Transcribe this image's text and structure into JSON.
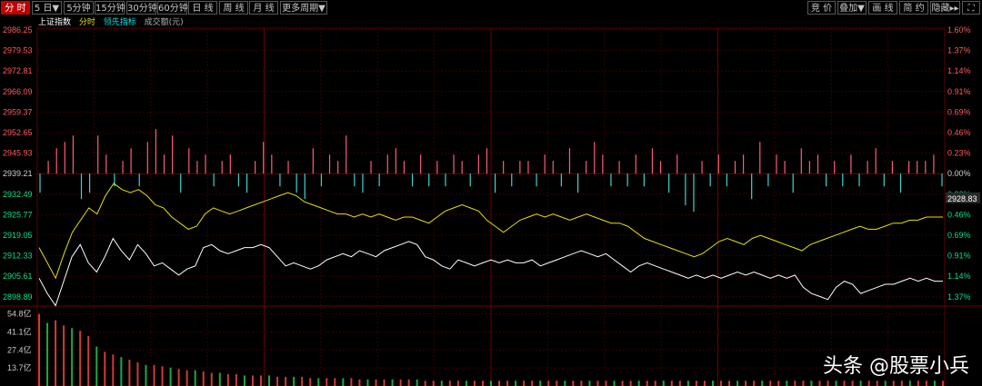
{
  "toolbar": {
    "left": [
      {
        "label": "分 时",
        "name": "tab-intraday",
        "active": true
      },
      {
        "label": "5 日▼",
        "name": "tab-5day",
        "active": false
      },
      {
        "label": "5分钟",
        "name": "tab-5min",
        "active": false
      },
      {
        "label": "15分钟",
        "name": "tab-15min",
        "active": false
      },
      {
        "label": "30分钟",
        "name": "tab-30min",
        "active": false
      },
      {
        "label": "60分钟",
        "name": "tab-60min",
        "active": false
      },
      {
        "label": "日 线",
        "name": "tab-daily",
        "active": false
      },
      {
        "label": "周 线",
        "name": "tab-weekly",
        "active": false
      },
      {
        "label": "月 线",
        "name": "tab-monthly",
        "active": false
      },
      {
        "label": "更多周期▼",
        "name": "tab-more-periods",
        "active": false
      }
    ],
    "right": [
      {
        "label": "竞 价",
        "name": "btn-auction"
      },
      {
        "label": "叠加▼",
        "name": "btn-overlay"
      },
      {
        "label": "画 线",
        "name": "btn-draw"
      },
      {
        "label": "简 约",
        "name": "btn-simple"
      },
      {
        "label": "隐藏▸▸",
        "name": "btn-hide"
      },
      {
        "label": "⛶",
        "name": "btn-fullscreen"
      }
    ]
  },
  "legend": {
    "index": "上证指数",
    "time": "分时",
    "leading": "领先指标",
    "volume": "成交额(元)"
  },
  "colors": {
    "up": "#ff4a4a",
    "down": "#00ff9c",
    "white_line": "#ffffff",
    "yellow_line": "#e3e300",
    "grid": "#3a0000",
    "volume_green": "#1aa84a",
    "volume_red": "#d03a3a"
  },
  "chart_data": {
    "type": "line",
    "price_axis": {
      "ticks": [
        2986.25,
        2979.53,
        2972.81,
        2966.09,
        2959.37,
        2952.65,
        2945.93,
        2939.21,
        2932.49,
        2925.77,
        2919.05,
        2912.33,
        2905.61,
        2898.89
      ],
      "tick_labels": [
        "2986.25",
        "2979.53",
        "2972.81",
        "2966.09",
        "2959.37",
        "2952.65",
        "2945.93",
        "2939.21",
        "2932.49",
        "2925.77",
        "2919.05",
        "2912.33",
        "2905.61",
        "2898.89"
      ],
      "base": 2939.21
    },
    "pct_axis": {
      "tick_labels": [
        "1.60%",
        "1.37%",
        "1.14%",
        "0.91%",
        "0.69%",
        "0.46%",
        "0.23%",
        "0.00%",
        "0.23%",
        "0.46%",
        "0.69%",
        "0.91%",
        "1.14%",
        "1.37%"
      ]
    },
    "current_price_label": "2928.83",
    "volume_axis": {
      "tick_labels": [
        "54.8亿",
        "41.1亿",
        "27.4亿",
        "13.7亿"
      ],
      "ticks": [
        54.8,
        41.1,
        27.4,
        13.7
      ]
    },
    "series": [
      {
        "color": "white",
        "values": [
          2905,
          2900,
          2896,
          2904,
          2912,
          2916,
          2910,
          2907,
          2912,
          2918,
          2914,
          2911,
          2916,
          2913,
          2909,
          2910,
          2908,
          2906,
          2908,
          2909,
          2915,
          2916,
          2914,
          2913,
          2914,
          2915,
          2915,
          2916,
          2915,
          2912,
          2909,
          2910,
          2909,
          2908,
          2909,
          2911,
          2912,
          2913,
          2912,
          2914,
          2913,
          2912,
          2914,
          2915,
          2916,
          2917,
          2916,
          2912,
          2911,
          2909,
          2908,
          2911,
          2910,
          2909,
          2910,
          2911,
          2910,
          2911,
          2910,
          2910,
          2911,
          2909,
          2910,
          2911,
          2912,
          2913,
          2914,
          2913,
          2912,
          2913,
          2911,
          2909,
          2907,
          2909,
          2910,
          2909,
          2908,
          2907,
          2906,
          2905,
          2906,
          2905,
          2906,
          2905,
          2906,
          2907,
          2906,
          2907,
          2906,
          2905,
          2906,
          2905,
          2906,
          2902,
          2900,
          2899,
          2898,
          2902,
          2904,
          2903,
          2900,
          2901,
          2902,
          2903,
          2903,
          2904,
          2905,
          2904,
          2905,
          2904,
          2904
        ]
      },
      {
        "color": "yellow",
        "values": [
          2915,
          2910,
          2905,
          2913,
          2920,
          2924,
          2928,
          2926,
          2932,
          2936,
          2934,
          2933,
          2934,
          2932,
          2929,
          2928,
          2925,
          2923,
          2921,
          2922,
          2926,
          2928,
          2927,
          2926,
          2927,
          2928,
          2929,
          2930,
          2931,
          2932,
          2933,
          2932,
          2930,
          2929,
          2928,
          2927,
          2926,
          2926,
          2925,
          2926,
          2925,
          2926,
          2925,
          2924,
          2925,
          2925,
          2924,
          2923,
          2925,
          2927,
          2928,
          2929,
          2928,
          2927,
          2924,
          2922,
          2920,
          2922,
          2924,
          2925,
          2926,
          2925,
          2926,
          2925,
          2924,
          2925,
          2926,
          2925,
          2924,
          2923,
          2923,
          2922,
          2920,
          2918,
          2917,
          2916,
          2915,
          2914,
          2913,
          2912,
          2913,
          2915,
          2917,
          2918,
          2917,
          2916,
          2918,
          2919,
          2918,
          2917,
          2916,
          2915,
          2914,
          2916,
          2917,
          2918,
          2919,
          2920,
          2921,
          2922,
          2921,
          2921,
          2922,
          2923,
          2923,
          2924,
          2924,
          2925,
          2925,
          2925
        ]
      }
    ],
    "volume_bars": [
      54.8,
      48,
      50,
      46,
      44,
      42,
      38,
      30,
      26,
      24,
      22,
      20,
      18,
      16,
      16,
      15,
      14,
      13,
      12,
      12,
      11,
      10,
      10,
      9,
      9,
      8,
      8,
      8,
      8,
      7,
      7,
      7,
      7,
      6,
      6,
      6,
      6,
      6,
      6,
      5,
      5,
      5,
      5,
      5,
      5,
      5,
      5,
      4,
      4,
      4,
      4,
      4,
      4,
      4,
      4,
      4,
      4,
      4,
      4,
      4,
      4,
      4,
      4,
      4,
      4,
      4,
      4,
      4,
      4,
      4,
      4,
      4,
      4,
      4,
      4,
      4,
      4,
      4,
      4,
      4,
      4,
      4,
      4,
      4,
      4,
      4,
      4,
      4,
      4,
      4,
      4,
      4,
      4,
      4,
      4,
      4,
      4,
      4,
      4,
      4,
      4,
      4,
      4,
      4,
      4,
      4,
      4,
      4,
      4,
      4,
      4
    ],
    "leading_bars": [
      -3,
      2,
      4,
      5,
      6,
      -4,
      -3,
      6,
      3,
      -2,
      2,
      4,
      -2,
      5,
      7,
      3,
      6,
      -3,
      4,
      2,
      3,
      -2,
      2,
      3,
      -2,
      -3,
      2,
      5,
      3,
      -2,
      2,
      -3,
      -4,
      4,
      -2,
      3,
      2,
      6,
      -2,
      -3,
      2,
      -2,
      3,
      4,
      2,
      -2,
      3,
      -2,
      2,
      -2,
      3,
      2,
      -2,
      3,
      4,
      -3,
      2,
      -2,
      2,
      2,
      -2,
      3,
      2,
      -2,
      4,
      -3,
      2,
      5,
      3,
      -2,
      2,
      -2,
      3,
      -2,
      4,
      2,
      -3,
      3,
      -5,
      -6,
      2,
      -2,
      3,
      -2,
      2,
      3,
      -4,
      5,
      -2,
      3,
      2,
      -3,
      4,
      2,
      3,
      -2,
      2,
      -2,
      3,
      -2,
      2,
      4,
      -2,
      2,
      -3,
      2,
      2,
      2,
      3,
      -2
    ]
  },
  "watermark": "头条 @股票小兵"
}
